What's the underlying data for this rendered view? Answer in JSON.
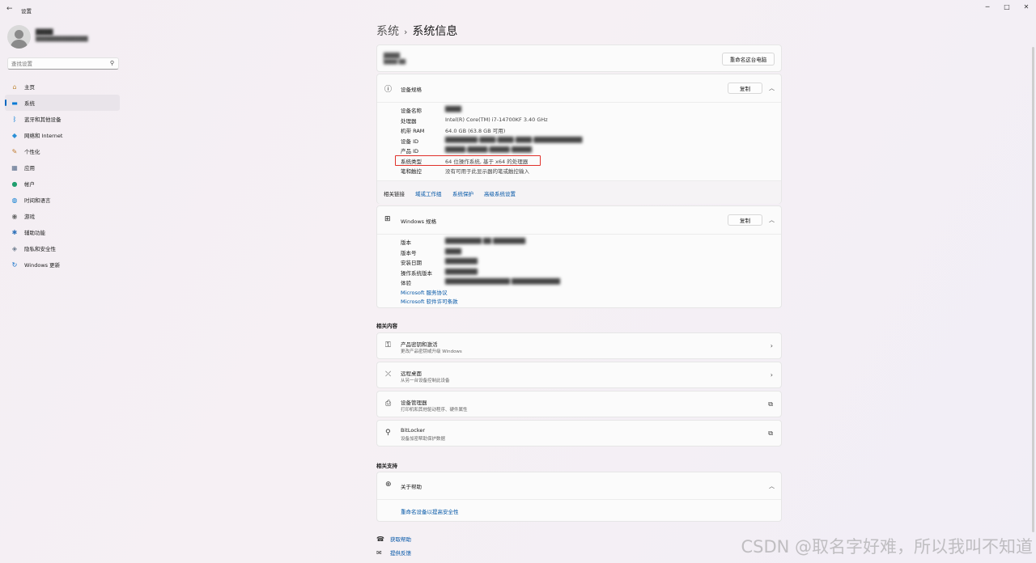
{
  "window": {
    "title": "设置",
    "back_glyph": "←",
    "minimize": "─",
    "maximize": "□",
    "close": "✕"
  },
  "user": {
    "name": "████",
    "email": "██████████████"
  },
  "search": {
    "placeholder": "查找设置"
  },
  "nav": {
    "items": [
      {
        "label": "主页",
        "icon": "home-icon",
        "glyph": "⌂",
        "color": "#c08a3e"
      },
      {
        "label": "系统",
        "icon": "system-icon",
        "glyph": "▬",
        "color": "#0078d4",
        "active": true
      },
      {
        "label": "蓝牙和其他设备",
        "icon": "bluetooth-icon",
        "glyph": "ᛒ",
        "color": "#0078d4"
      },
      {
        "label": "网络和 Internet",
        "icon": "network-icon",
        "glyph": "◆",
        "color": "#2b8fd6"
      },
      {
        "label": "个性化",
        "icon": "personalization-icon",
        "glyph": "✎",
        "color": "#c07a2e"
      },
      {
        "label": "应用",
        "icon": "apps-icon",
        "glyph": "▦",
        "color": "#5a6e8c"
      },
      {
        "label": "帐户",
        "icon": "accounts-icon",
        "glyph": "●",
        "color": "#1f9e6e"
      },
      {
        "label": "时间和语言",
        "icon": "time-language-icon",
        "glyph": "◍",
        "color": "#0a7bd0"
      },
      {
        "label": "游戏",
        "icon": "gaming-icon",
        "glyph": "◉",
        "color": "#6b6b6b"
      },
      {
        "label": "辅助功能",
        "icon": "accessibility-icon",
        "glyph": "✱",
        "color": "#2d6fb8"
      },
      {
        "label": "隐私和安全性",
        "icon": "privacy-shield-icon",
        "glyph": "◈",
        "color": "#6d7c8e"
      },
      {
        "label": "Windows 更新",
        "icon": "windows-update-icon",
        "glyph": "↻",
        "color": "#0a6cc8"
      }
    ]
  },
  "breadcrumb": {
    "parent": "系统",
    "sep": "›",
    "current": "系统信息"
  },
  "device_card": {
    "name": "████",
    "model": "████ ██",
    "rename_btn": "重命名这台电脑"
  },
  "device_specs": {
    "title": "设备规格",
    "icon_glyph": "ⓘ",
    "copy_btn": "复制",
    "collapse_glyph": "︿",
    "rows": [
      {
        "label": "设备名称",
        "value": "████",
        "blur": true
      },
      {
        "label": "处理器",
        "value": "Intel(R) Core(TM) i7-14700KF   3.40 GHz",
        "blur": false
      },
      {
        "label": "机带 RAM",
        "value": "64.0 GB (63.8 GB 可用)",
        "blur": false
      },
      {
        "label": "设备 ID",
        "value": "████████-████-████-████-████████████",
        "blur": true
      },
      {
        "label": "产品 ID",
        "value": "█████-█████-█████-█████",
        "blur": true
      },
      {
        "label": "系统类型",
        "value": "64 位操作系统, 基于 x64 的处理器",
        "blur": false
      },
      {
        "label": "笔和触控",
        "value": "没有可用于此显示器的笔或触控输入",
        "blur": false
      }
    ],
    "related_label": "相关链接",
    "links": [
      "域或工作组",
      "系统保护",
      "高级系统设置"
    ]
  },
  "windows_specs": {
    "title": "Windows 规格",
    "icon_glyph": "⊞",
    "copy_btn": "复制",
    "collapse_glyph": "︿",
    "rows": [
      {
        "label": "版本",
        "value": "█████████ ██ ████████"
      },
      {
        "label": "版本号",
        "value": "████"
      },
      {
        "label": "安装日期",
        "value": "████████"
      },
      {
        "label": "操作系统版本",
        "value": "████████"
      },
      {
        "label": "体验",
        "value": "████████████████ ████████████"
      }
    ],
    "links": [
      "Microsoft 服务协议",
      "Microsoft 软件许可条款"
    ]
  },
  "related_content": {
    "title": "相关内容",
    "items": [
      {
        "title": "产品密钥和激活",
        "subtitle": "更改产品密钥或升级 Windows",
        "icon": "key-icon",
        "glyph": "⚿",
        "arrow": "›"
      },
      {
        "title": "远程桌面",
        "subtitle": "从另一台设备控制此设备",
        "icon": "remote-desktop-icon",
        "glyph": "⤫",
        "arrow": "›"
      },
      {
        "title": "设备管理器",
        "subtitle": "打印机和其他驱动程序、硬件属性",
        "icon": "device-manager-icon",
        "glyph": "⎙",
        "arrow": "⧉"
      },
      {
        "title": "BitLocker",
        "subtitle": "设备加密帮助保护数据",
        "icon": "bitlocker-icon",
        "glyph": "⚲",
        "arrow": "⧉"
      }
    ]
  },
  "related_support": {
    "title": "相关支持",
    "help_title": "关于帮助",
    "help_icon_glyph": "⊕",
    "collapse_glyph": "︿",
    "help_link": "重命名设备以提高安全性"
  },
  "footer": {
    "get_help": "获取帮助",
    "feedback": "提供反馈",
    "help_glyph": "☎",
    "feedback_glyph": "✉"
  },
  "watermark": "CSDN @取名字好难，所以我叫不知道",
  "colors": {
    "accent": "#0067c0",
    "link": "#0055a6",
    "highlight_box": "#e0302a"
  }
}
